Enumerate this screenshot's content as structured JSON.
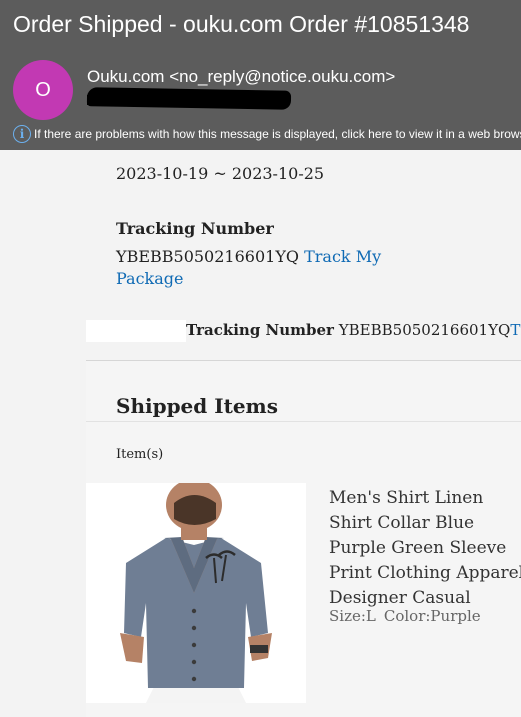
{
  "email": {
    "subject": "Order Shipped - ouku.com Order #10851348",
    "avatar_initial": "O",
    "sender": "Ouku.com <no_reply@notice.ouku.com>",
    "info_bar": "If there are problems with how this message is displayed, click here to view it in a web browser."
  },
  "shipment": {
    "delivery_dates": "2023-10-19 ~ 2023-10-25",
    "tracking_label": "Tracking Number",
    "tracking_number": "YBEBB5050216601YQ",
    "track_link_1": "Track My",
    "track_link_2": "Package",
    "tracking_row_label": "Tracking Number",
    "tracking_row_value": "YBEBB5050216601YQ",
    "tracking_row_link": "Track My Package"
  },
  "items": {
    "section_title": "Shipped Items",
    "column_label": "Item(s)",
    "products": [
      {
        "title": "Men's Shirt Linen Shirt Collar Blue Purple Green Sleeve Print Clothing Apparel Designer Casual",
        "size": "Size:L",
        "color": "Color:Purple"
      }
    ]
  },
  "colors": {
    "header": "#5c5c5c",
    "avatar": "#c239b3",
    "link": "#0f6ab4",
    "info_icon": "#6cb0ee"
  }
}
